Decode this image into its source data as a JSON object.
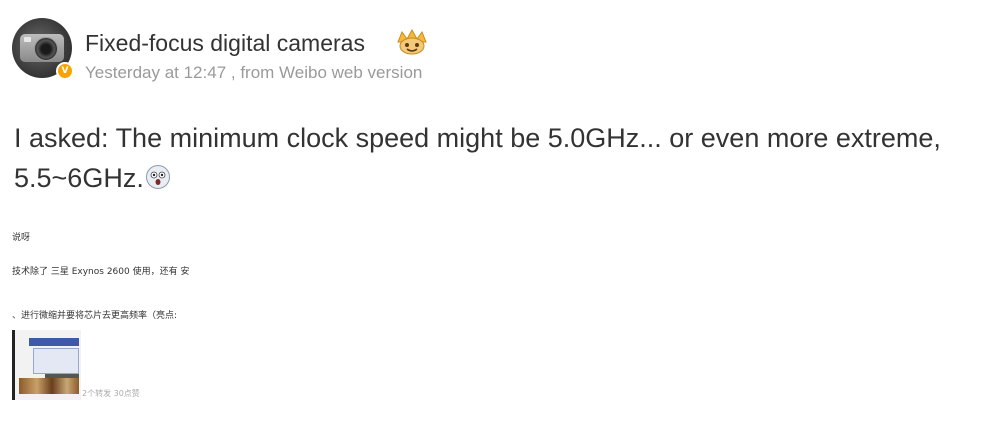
{
  "post": {
    "author": "Fixed-focus digital cameras",
    "meta": "Yesterday at 12:47 , from Weibo web version",
    "text": "I asked: The minimum clock speed might be 5.0GHz... or even more extreme, 5.5~6GHz.",
    "avatar_icon": "camera-avatar",
    "badge_icon": "verified-v-icon",
    "badge_glyph": "V",
    "badge_color": "#f7a400",
    "author_emoji": "crown-face-emoji",
    "text_emoji": "shocked-face-emoji"
  },
  "embedded_screenshot": {
    "line1": "说呀",
    "line2": "技术除了 三星 Exynos 2600 使用，还有 安",
    "line3": "、进行微缩并要将芯片去更高频率（亮点:",
    "caption": "2个转发 30点赞"
  },
  "colors": {
    "text": "#333333",
    "meta": "#9a9a9a",
    "background": "#ffffff"
  }
}
